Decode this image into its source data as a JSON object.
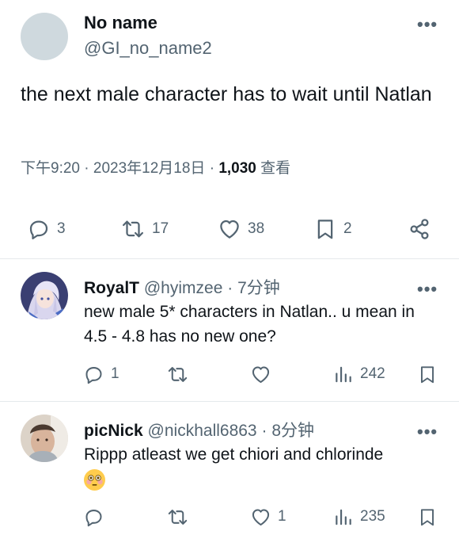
{
  "main_tweet": {
    "display_name": "No name",
    "handle": "@GI_no_name2",
    "text": "the next male character has to wait until Natlan",
    "time": "下午9:20",
    "date": "2023年12月18日",
    "views_count": "1,030",
    "views_label": "查看",
    "actions": {
      "replies": "3",
      "retweets": "17",
      "likes": "38",
      "bookmarks": "2"
    }
  },
  "replies": [
    {
      "display_name": "RoyalT",
      "handle": "@hyimzee",
      "time": "7分钟",
      "text": "new male 5* characters in Natlan.. u mean in 4.5 - 4.8 has no new one?",
      "replies": "1",
      "retweets": "",
      "likes": "",
      "views": "242"
    },
    {
      "display_name": "picNick",
      "handle": "@nickhall6863",
      "time": "8分钟",
      "text": "Rippp atleast we get chiori and chlorinde",
      "emoji": "flushed-face-emoji",
      "replies": "",
      "retweets": "",
      "likes": "1",
      "views": "235"
    }
  ],
  "icons": {
    "reply": "reply-icon",
    "retweet": "retweet-icon",
    "like": "heart-icon",
    "bookmark": "bookmark-icon",
    "share": "share-icon",
    "views": "views-icon",
    "more": "more-icon"
  },
  "colors": {
    "text_primary": "#0f1419",
    "text_secondary": "#536471",
    "divider": "#e5e9ec",
    "avatar_placeholder": "#cfd9de"
  }
}
